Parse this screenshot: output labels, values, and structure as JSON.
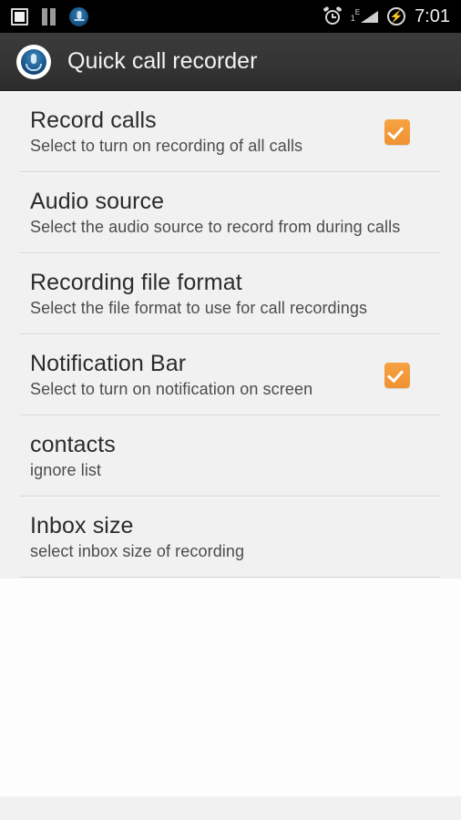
{
  "status_bar": {
    "left_icons": [
      {
        "name": "stop-square-icon",
        "label": "stop"
      },
      {
        "name": "pause-icon",
        "label": "pause"
      },
      {
        "name": "app-notification-icon",
        "label": "Quick call recorder"
      }
    ],
    "right_icons": [
      {
        "name": "alarm-clock-icon",
        "label": "alarm set"
      },
      {
        "name": "signal-bars-icon",
        "sim": "1",
        "network": "E"
      },
      {
        "name": "battery-charging-icon",
        "label": "charging"
      }
    ],
    "time": "7:01",
    "background_color": "#000000"
  },
  "action_bar": {
    "icon_name": "app-logo-microphone-icon",
    "title": "Quick call recorder",
    "background_color": "#343434",
    "title_color": "#f2f2f2"
  },
  "theme": {
    "accent_color": "#f09233",
    "list_background": "#f1f1f1",
    "tail_background": "#fdfdfd",
    "divider_color": "#d6d6d6"
  },
  "preferences": [
    {
      "key": "record-calls",
      "title": "Record calls",
      "summary": "Select to turn on recording of all calls",
      "widget": "checkbox",
      "checked": true
    },
    {
      "key": "audio-source",
      "title": "Audio source",
      "summary": "Select the audio source to record from during calls",
      "widget": "none",
      "checked": false
    },
    {
      "key": "recording-file-format",
      "title": "Recording file format",
      "summary": "Select the file format to use for call recordings",
      "widget": "none",
      "checked": false
    },
    {
      "key": "notification-bar",
      "title": "Notification Bar",
      "summary": "Select to turn on notification on screen",
      "widget": "checkbox",
      "checked": true
    },
    {
      "key": "contacts",
      "title": "contacts",
      "summary": "ignore list",
      "widget": "none",
      "checked": false
    },
    {
      "key": "inbox-size",
      "title": "Inbox size",
      "summary": "select inbox size of recording",
      "widget": "none",
      "checked": false
    }
  ]
}
